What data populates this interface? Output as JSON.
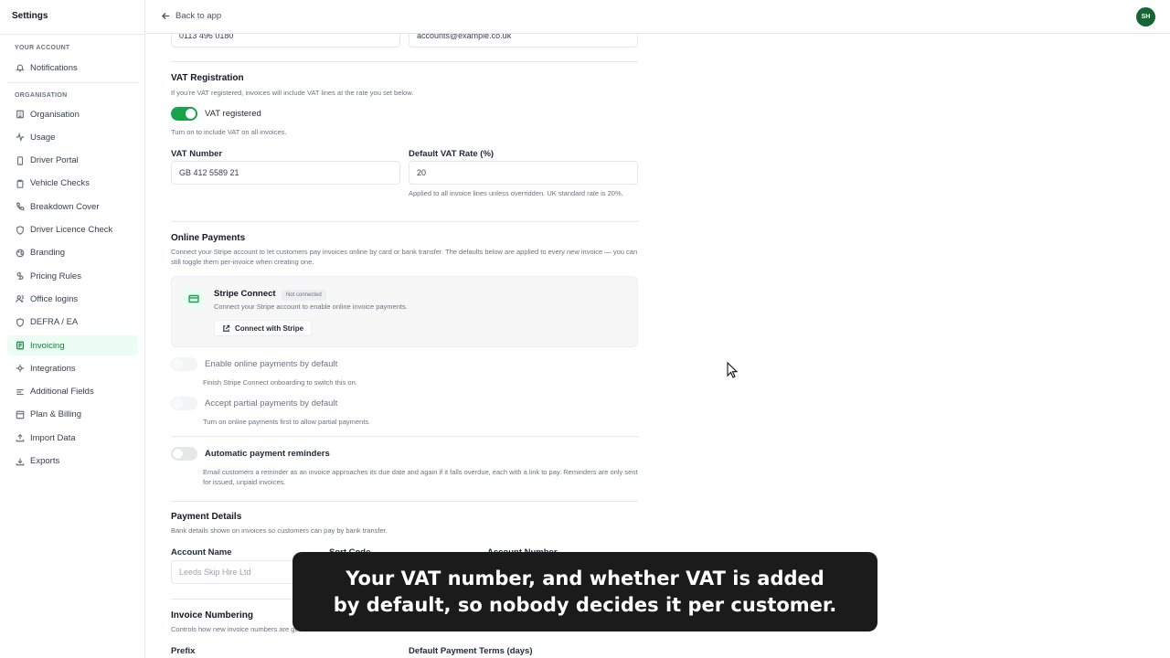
{
  "sidebar": {
    "title": "Settings",
    "section_account": "YOUR ACCOUNT",
    "section_org": "ORGANISATION",
    "account_items": [
      {
        "label": "Notifications",
        "icon": "bell-icon"
      }
    ],
    "org_items": [
      {
        "label": "Organisation",
        "icon": "building-icon"
      },
      {
        "label": "Usage",
        "icon": "activity-icon"
      },
      {
        "label": "Driver Portal",
        "icon": "phone-icon"
      },
      {
        "label": "Vehicle Checks",
        "icon": "clipboard-icon"
      },
      {
        "label": "Breakdown Cover",
        "icon": "phone-call-icon"
      },
      {
        "label": "Driver Licence Check",
        "icon": "shield-icon"
      },
      {
        "label": "Branding",
        "icon": "palette-icon"
      },
      {
        "label": "Pricing Rules",
        "icon": "tag-icon"
      },
      {
        "label": "Office logins",
        "icon": "users-icon"
      },
      {
        "label": "DEFRA / EA",
        "icon": "shield-icon"
      },
      {
        "label": "Invoicing",
        "icon": "receipt-icon",
        "active": true
      },
      {
        "label": "Integrations",
        "icon": "plug-icon"
      },
      {
        "label": "Additional Fields",
        "icon": "list-icon"
      },
      {
        "label": "Plan & Billing",
        "icon": "card-icon"
      },
      {
        "label": "Import Data",
        "icon": "upload-icon"
      },
      {
        "label": "Exports",
        "icon": "download-icon"
      }
    ]
  },
  "topbar": {
    "back_label": "Back to app",
    "avatar_initials": "SH"
  },
  "contact": {
    "phone_value": "0113 496 0180",
    "email_value": "accounts@example.co.uk"
  },
  "vat": {
    "heading": "VAT Registration",
    "description": "If you're VAT registered, invoices will include VAT lines at the rate you set below.",
    "toggle_label": "VAT registered",
    "toggle_on": true,
    "toggle_help": "Turn on to include VAT on all invoices.",
    "number_label": "VAT Number",
    "number_value": "GB 412 5589 21",
    "rate_label": "Default VAT Rate (%)",
    "rate_value": "20",
    "rate_help": "Applied to all invoice lines unless overridden. UK standard rate is 20%."
  },
  "online_payments": {
    "heading": "Online Payments",
    "description": "Connect your Stripe account to let customers pay invoices online by card or bank transfer. The defaults below are applied to every new invoice — you can still toggle them per-invoice when creating one.",
    "stripe_title": "Stripe Connect",
    "stripe_badge": "Not connected",
    "stripe_desc": "Connect your Stripe account to enable online invoice payments.",
    "stripe_button": "Connect with Stripe",
    "enable_label": "Enable online payments by default",
    "enable_help": "Finish Stripe Connect onboarding to switch this on.",
    "partial_label": "Accept partial payments by default",
    "partial_help": "Turn on online payments first to allow partial payments.",
    "reminders_label": "Automatic payment reminders",
    "reminders_help": "Email customers a reminder as an invoice approaches its due date and again if it falls overdue, each with a link to pay. Reminders are only sent for issued, unpaid invoices."
  },
  "payment_details": {
    "heading": "Payment Details",
    "description": "Bank details shown on invoices so customers can pay by bank transfer.",
    "account_name_label": "Account Name",
    "account_name_placeholder": "Leeds Skip Hire Ltd",
    "sort_code_label": "Sort Code",
    "account_number_label": "Account Number"
  },
  "invoice_numbering": {
    "heading": "Invoice Numbering",
    "description": "Controls how new invoice numbers are generated.",
    "prefix_label": "Prefix",
    "terms_label": "Default Payment Terms (days)"
  },
  "caption": {
    "line1": "Your VAT number, and whether VAT is added",
    "line2": "by default, so nobody decides it per customer."
  },
  "colors": {
    "accent": "#16a34a",
    "active_bg": "#ecfdf3",
    "caption_bg": "#1b1b1b"
  }
}
